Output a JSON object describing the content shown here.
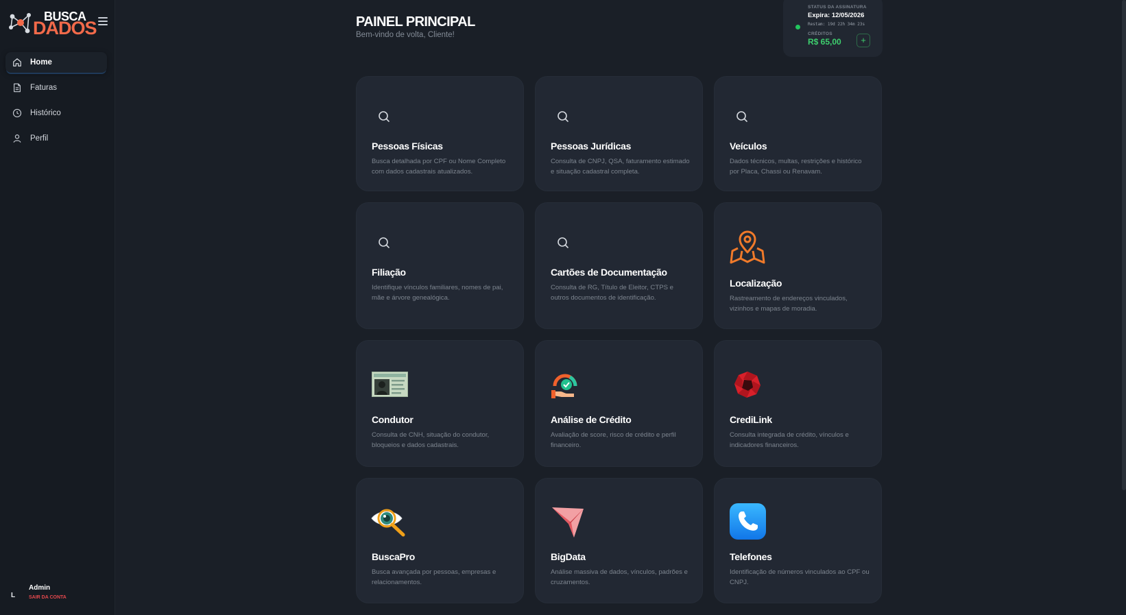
{
  "brand": {
    "word1": "BUSCA",
    "word2": "DADOS"
  },
  "sidebar": {
    "items": [
      {
        "label": "Home",
        "icon": "home-icon"
      },
      {
        "label": "Faturas",
        "icon": "invoice-icon"
      },
      {
        "label": "Histórico",
        "icon": "clock-icon"
      },
      {
        "label": "Perfil",
        "icon": "user-icon"
      }
    ],
    "account": {
      "initial": "L",
      "name": "Admin",
      "logout": "SAIR DA CONTA"
    }
  },
  "header": {
    "title": "PAINEL PRINCIPAL",
    "subtitle": "Bem-vindo de volta, Cliente!"
  },
  "status": {
    "label": "STATUS DA ASSINATURA",
    "expires": "Expira: 12/05/2026",
    "remaining": "Restam: 19d 22h 34m 23s",
    "credits_label": "CRÉDITOS",
    "credits_value": "R$ 65,00",
    "add_label": "+",
    "online_color": "#22c55e"
  },
  "cards": [
    {
      "title": "Pessoas Físicas",
      "desc": "Busca detalhada por CPF ou Nome Completo com dados cadastrais atualizados.",
      "icon": "search-icon"
    },
    {
      "title": "Pessoas Jurídicas",
      "desc": "Consulta de CNPJ, QSA, faturamento estimado e situação cadastral completa.",
      "icon": "search-icon"
    },
    {
      "title": "Veículos",
      "desc": "Dados técnicos, multas, restrições e histórico por Placa, Chassi ou Renavam.",
      "icon": "search-icon"
    },
    {
      "title": "Filiação",
      "desc": "Identifique vínculos familiares, nomes de pai, mãe e árvore genealógica.",
      "icon": "search-icon"
    },
    {
      "title": "Cartões de Documentação",
      "desc": "Consulta de RG, Título de Eleitor, CTPS e outros documentos de identificação.",
      "icon": "search-icon"
    },
    {
      "title": "Localização",
      "desc": "Rastreamento de endereços vinculados, vizinhos e mapas de moradia.",
      "icon": "map-pin-icon"
    },
    {
      "title": "Condutor",
      "desc": "Consulta de CNH, situação do condutor, bloqueios e dados cadastrais.",
      "icon": "driver-license-icon"
    },
    {
      "title": "Análise de Crédito",
      "desc": "Avaliação de score, risco de crédito e perfil financeiro.",
      "icon": "credit-score-icon"
    },
    {
      "title": "CrediLink",
      "desc": "Consulta integrada de crédito, vínculos e indicadores financeiros.",
      "icon": "shutter-icon"
    },
    {
      "title": "BuscaPro",
      "desc": "Busca avançada por pessoas, empresas e relacionamentos.",
      "icon": "eye-magnifier-icon"
    },
    {
      "title": "BigData",
      "desc": "Análise massiva de dados, vínculos, padrões e cruzamentos.",
      "icon": "arrow-icon"
    },
    {
      "title": "Telefones",
      "desc": "Identificação de números vinculados ao CPF ou CNPJ.",
      "icon": "phone-icon"
    }
  ],
  "colors": {
    "accent": "#f26a4a",
    "credit": "#3ecf6e",
    "danger": "#e5484d",
    "card": "#222833",
    "background": "#1a1f27"
  }
}
